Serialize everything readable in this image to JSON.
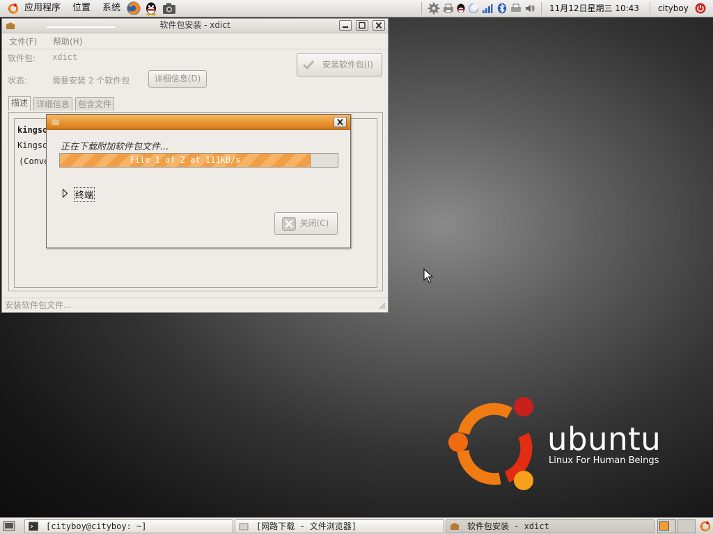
{
  "top_panel": {
    "menus": [
      "应用程序",
      "位置",
      "系统"
    ],
    "datetime": "11月12日星期三 10:43",
    "user": "cityboy"
  },
  "pkg_window": {
    "title": "软件包安装 - xdict",
    "menu": [
      "文件(F)",
      "帮助(H)"
    ],
    "package_label": "软件包:",
    "package_value": "xdict",
    "status_label": "状态:",
    "status_value": "需要安装 2 个软件包",
    "details_button": "详细信息(D)",
    "install_button": "安装软件包(I)",
    "tabs": [
      "描述",
      "详细信息",
      "包含文件"
    ],
    "description_lines": [
      "kingsoft",
      "Kingsoft",
      "(Conve"
    ],
    "status_bar": "安装软件包文件..."
  },
  "dialog": {
    "message": "正在下载附加软件包文件...",
    "progress_text": "File 1 of 2 at 111kB/s",
    "progress_fraction": 0.9,
    "terminal_label": "终端",
    "close_button": "关闭(C)"
  },
  "wallpaper": {
    "word": "ubuntu",
    "tagline": "Linux For Human Beings"
  },
  "taskbar": {
    "tasks": [
      {
        "label": "[cityboy@cityboy: ~]",
        "active": false
      },
      {
        "label": "[网路下载 - 文件浏览器]",
        "active": false
      },
      {
        "label": "软件包安装 - xdict",
        "active": true
      }
    ]
  },
  "colors": {
    "accent_orange": "#e99530",
    "ubuntu_orange": "#f07b12",
    "ubuntu_red": "#d7241c"
  }
}
